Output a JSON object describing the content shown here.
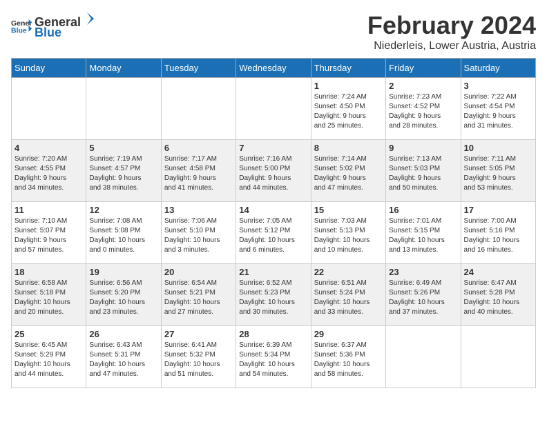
{
  "logo": {
    "general": "General",
    "blue": "Blue"
  },
  "title": "February 2024",
  "subtitle": "Niederleis, Lower Austria, Austria",
  "days_of_week": [
    "Sunday",
    "Monday",
    "Tuesday",
    "Wednesday",
    "Thursday",
    "Friday",
    "Saturday"
  ],
  "weeks": [
    [
      {
        "day": "",
        "info": ""
      },
      {
        "day": "",
        "info": ""
      },
      {
        "day": "",
        "info": ""
      },
      {
        "day": "",
        "info": ""
      },
      {
        "day": "1",
        "info": "Sunrise: 7:24 AM\nSunset: 4:50 PM\nDaylight: 9 hours\nand 25 minutes."
      },
      {
        "day": "2",
        "info": "Sunrise: 7:23 AM\nSunset: 4:52 PM\nDaylight: 9 hours\nand 28 minutes."
      },
      {
        "day": "3",
        "info": "Sunrise: 7:22 AM\nSunset: 4:54 PM\nDaylight: 9 hours\nand 31 minutes."
      }
    ],
    [
      {
        "day": "4",
        "info": "Sunrise: 7:20 AM\nSunset: 4:55 PM\nDaylight: 9 hours\nand 34 minutes."
      },
      {
        "day": "5",
        "info": "Sunrise: 7:19 AM\nSunset: 4:57 PM\nDaylight: 9 hours\nand 38 minutes."
      },
      {
        "day": "6",
        "info": "Sunrise: 7:17 AM\nSunset: 4:58 PM\nDaylight: 9 hours\nand 41 minutes."
      },
      {
        "day": "7",
        "info": "Sunrise: 7:16 AM\nSunset: 5:00 PM\nDaylight: 9 hours\nand 44 minutes."
      },
      {
        "day": "8",
        "info": "Sunrise: 7:14 AM\nSunset: 5:02 PM\nDaylight: 9 hours\nand 47 minutes."
      },
      {
        "day": "9",
        "info": "Sunrise: 7:13 AM\nSunset: 5:03 PM\nDaylight: 9 hours\nand 50 minutes."
      },
      {
        "day": "10",
        "info": "Sunrise: 7:11 AM\nSunset: 5:05 PM\nDaylight: 9 hours\nand 53 minutes."
      }
    ],
    [
      {
        "day": "11",
        "info": "Sunrise: 7:10 AM\nSunset: 5:07 PM\nDaylight: 9 hours\nand 57 minutes."
      },
      {
        "day": "12",
        "info": "Sunrise: 7:08 AM\nSunset: 5:08 PM\nDaylight: 10 hours\nand 0 minutes."
      },
      {
        "day": "13",
        "info": "Sunrise: 7:06 AM\nSunset: 5:10 PM\nDaylight: 10 hours\nand 3 minutes."
      },
      {
        "day": "14",
        "info": "Sunrise: 7:05 AM\nSunset: 5:12 PM\nDaylight: 10 hours\nand 6 minutes."
      },
      {
        "day": "15",
        "info": "Sunrise: 7:03 AM\nSunset: 5:13 PM\nDaylight: 10 hours\nand 10 minutes."
      },
      {
        "day": "16",
        "info": "Sunrise: 7:01 AM\nSunset: 5:15 PM\nDaylight: 10 hours\nand 13 minutes."
      },
      {
        "day": "17",
        "info": "Sunrise: 7:00 AM\nSunset: 5:16 PM\nDaylight: 10 hours\nand 16 minutes."
      }
    ],
    [
      {
        "day": "18",
        "info": "Sunrise: 6:58 AM\nSunset: 5:18 PM\nDaylight: 10 hours\nand 20 minutes."
      },
      {
        "day": "19",
        "info": "Sunrise: 6:56 AM\nSunset: 5:20 PM\nDaylight: 10 hours\nand 23 minutes."
      },
      {
        "day": "20",
        "info": "Sunrise: 6:54 AM\nSunset: 5:21 PM\nDaylight: 10 hours\nand 27 minutes."
      },
      {
        "day": "21",
        "info": "Sunrise: 6:52 AM\nSunset: 5:23 PM\nDaylight: 10 hours\nand 30 minutes."
      },
      {
        "day": "22",
        "info": "Sunrise: 6:51 AM\nSunset: 5:24 PM\nDaylight: 10 hours\nand 33 minutes."
      },
      {
        "day": "23",
        "info": "Sunrise: 6:49 AM\nSunset: 5:26 PM\nDaylight: 10 hours\nand 37 minutes."
      },
      {
        "day": "24",
        "info": "Sunrise: 6:47 AM\nSunset: 5:28 PM\nDaylight: 10 hours\nand 40 minutes."
      }
    ],
    [
      {
        "day": "25",
        "info": "Sunrise: 6:45 AM\nSunset: 5:29 PM\nDaylight: 10 hours\nand 44 minutes."
      },
      {
        "day": "26",
        "info": "Sunrise: 6:43 AM\nSunset: 5:31 PM\nDaylight: 10 hours\nand 47 minutes."
      },
      {
        "day": "27",
        "info": "Sunrise: 6:41 AM\nSunset: 5:32 PM\nDaylight: 10 hours\nand 51 minutes."
      },
      {
        "day": "28",
        "info": "Sunrise: 6:39 AM\nSunset: 5:34 PM\nDaylight: 10 hours\nand 54 minutes."
      },
      {
        "day": "29",
        "info": "Sunrise: 6:37 AM\nSunset: 5:36 PM\nDaylight: 10 hours\nand 58 minutes."
      },
      {
        "day": "",
        "info": ""
      },
      {
        "day": "",
        "info": ""
      }
    ]
  ]
}
